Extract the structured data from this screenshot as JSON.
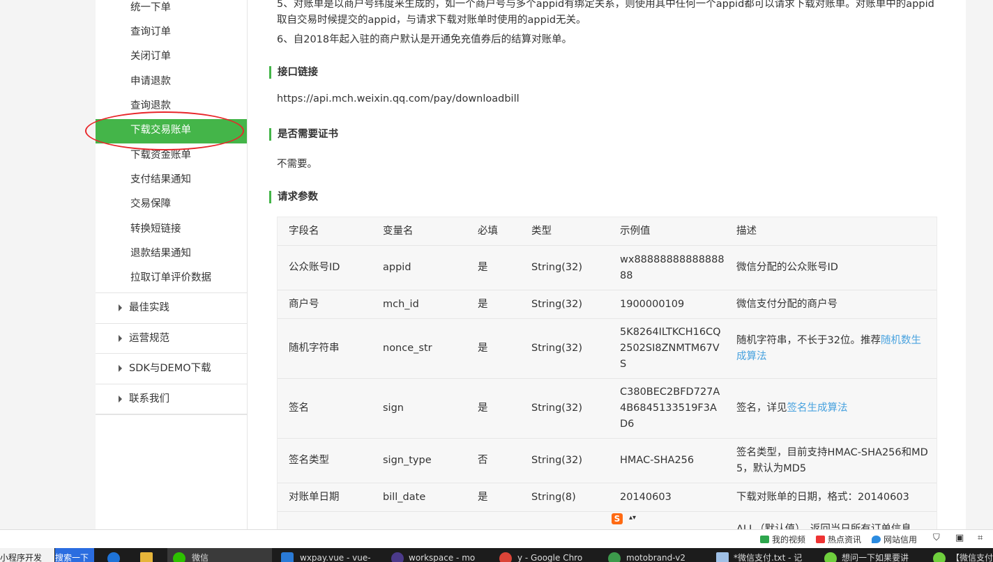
{
  "sidebar": {
    "sub_items": [
      "统一下单",
      "查询订单",
      "关闭订单",
      "申请退款",
      "查询退款",
      "下载交易账单",
      "下载资金账单",
      "支付结果通知",
      "交易保障",
      "转换短链接",
      "退款结果通知",
      "拉取订单评价数据"
    ],
    "active_item": "下载交易账单",
    "groups": [
      "最佳实践",
      "运营规范",
      "SDK与DEMO下载",
      "联系我们"
    ]
  },
  "content": {
    "paragraph_5_line1": "5、对账单是以商户号纬度来生成的，如一个商户号与多个appid有绑定关系，则使用其中任何一个appid都可以请求下载对账单。对账单中的appid",
    "paragraph_5_line2": "取自交易时候提交的appid，与请求下载对账单时使用的appid无关。",
    "paragraph_6": "6、自2018年起入驻的商户默认是开通免充值券后的结算对账单。",
    "section_api_title": "接口链接",
    "api_url": "https://api.mch.weixin.qq.com/pay/downloadbill",
    "section_cert_title": "是否需要证书",
    "cert_text": "不需要。",
    "section_params_title": "请求参数"
  },
  "params_table": {
    "headers": [
      "字段名",
      "变量名",
      "必填",
      "类型",
      "示例值",
      "描述"
    ],
    "rows": [
      {
        "name": "公众账号ID",
        "var": "appid",
        "required": "是",
        "type": "String(32)",
        "example": "wx8888888888888888",
        "desc": "微信分配的公众账号ID"
      },
      {
        "name": "商户号",
        "var": "mch_id",
        "required": "是",
        "type": "String(32)",
        "example": "1900000109",
        "desc": "微信支付分配的商户号"
      },
      {
        "name": "随机字符串",
        "var": "nonce_str",
        "required": "是",
        "type": "String(32)",
        "example": "5K8264ILTKCH16CQ2502SI8ZNMTM67VS",
        "desc": "随机字符串，不长于32位。推荐",
        "desc_link": "随机数生成算法"
      },
      {
        "name": "签名",
        "var": "sign",
        "required": "是",
        "type": "String(32)",
        "example": "C380BEC2BFD727A4B6845133519F3AD6",
        "desc": "签名，详见",
        "desc_link": "签名生成算法"
      },
      {
        "name": "签名类型",
        "var": "sign_type",
        "required": "否",
        "type": "String(32)",
        "example": "HMAC-SHA256",
        "desc": "签名类型，目前支持HMAC-SHA256和MD5，默认为MD5"
      },
      {
        "name": "对账单日期",
        "var": "bill_date",
        "required": "是",
        "type": "String(8)",
        "example": "20140603",
        "desc": "下载对账单的日期，格式：20140603"
      },
      {
        "name": "",
        "var": "",
        "required": "",
        "type": "",
        "example": "",
        "desc": "ALL（默认值），返回当日所有订单信息"
      }
    ]
  },
  "statusbar": {
    "my_video": "我的视频",
    "hot_news": "热点资讯",
    "site_credit": "网站信用"
  },
  "taskbar": {
    "items": [
      "小程序开发",
      "搜索一下",
      "微信",
      "wxpay.vue - vue-",
      "workspace - mo",
      "y - Google Chro",
      "motobrand-v2",
      "*微信支付.txt - 记",
      "想问一下如果要讲",
      "【微信支付"
    ]
  }
}
